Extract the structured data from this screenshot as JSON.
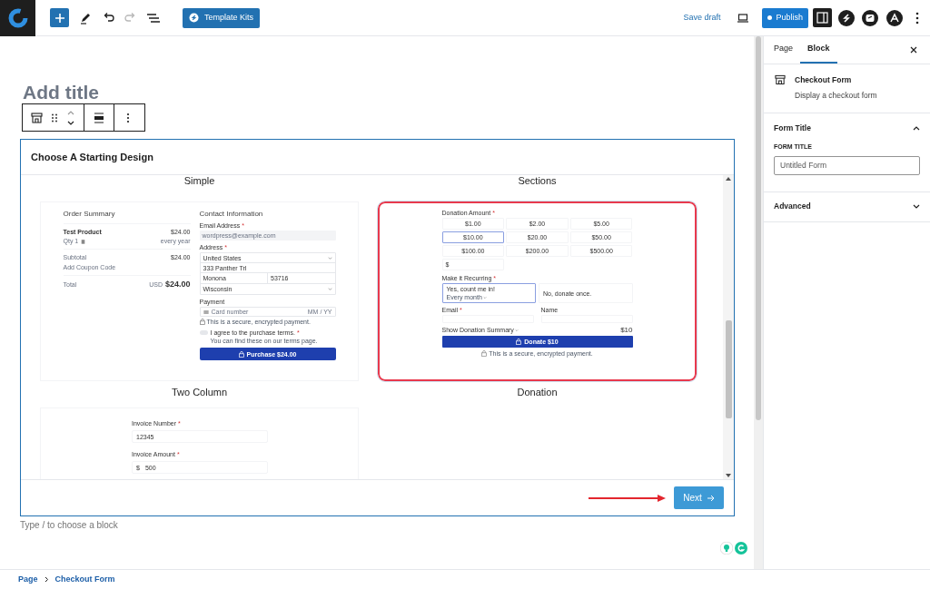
{
  "toolbar": {
    "template_kits": "Template Kits",
    "save_draft": "Save draft",
    "publish": "Publish",
    "redo_disabled": true,
    "settings_open": true
  },
  "editor": {
    "title_placeholder": "Add title",
    "appender_hint": "Type / to choose a block"
  },
  "design_picker": {
    "title": "Choose A Starting Design",
    "scrolled_labels": [
      "Simple",
      "Sections"
    ],
    "next": "Next",
    "designs": [
      {
        "kind": "two_column",
        "label": "Two Column",
        "selected": false,
        "order": {
          "title": "Order Summary",
          "product": "Test Product",
          "price": "$24.00",
          "qty": "Qty 1",
          "interval": "every year",
          "subtotal_label": "Subtotal",
          "subtotal": "$24.00",
          "coupon": "Add Coupon Code",
          "total_label": "Total",
          "currency": "USD",
          "total": "$24.00"
        },
        "contact": {
          "title": "Contact Information",
          "email_label": "Email Address",
          "email_mark": "*",
          "email_placeholder": "wordpress@example.com",
          "address_label": "Address",
          "address_mark": "*",
          "country": "United States",
          "street": "333 Panther Trl",
          "city": "Monona",
          "zip": "53716",
          "state": "Wisconsin",
          "payment_label": "Payment",
          "card_placeholder": "Card number",
          "expiry_placeholder": "MM / YY",
          "secure_note": "This is a secure, encrypted payment.",
          "terms": "I agree to the purchase terms.",
          "terms_mark": "*",
          "terms_note": "You can find these on our terms page.",
          "button": "Purchase $24.00"
        }
      },
      {
        "kind": "donation",
        "label": "Donation",
        "selected": true,
        "amount_label": "Donation Amount",
        "amount_mark": "*",
        "amounts": [
          {
            "text": "$1.00",
            "selected": false
          },
          {
            "text": "$2.00",
            "selected": false
          },
          {
            "text": "$5.00",
            "selected": false
          },
          {
            "text": "$10.00",
            "selected": true
          },
          {
            "text": "$20.00",
            "selected": false
          },
          {
            "text": "$50.00",
            "selected": false
          },
          {
            "text": "$100.00",
            "selected": false
          },
          {
            "text": "$200.00",
            "selected": false
          },
          {
            "text": "$500.00",
            "selected": false
          }
        ],
        "custom_amount": "$",
        "recurring_label": "Make it Recurring",
        "recurring_mark": "*",
        "recurring_options": [
          {
            "text": "Yes, count me in!",
            "detail": "Every month",
            "selected": true
          },
          {
            "text": "No, donate once.",
            "selected": false
          }
        ],
        "email_label": "Email",
        "email_mark": "*",
        "name_label": "Name",
        "summary_toggle": "Show Donation Summary",
        "summary_total": "$10",
        "button": "Donate $10",
        "secure_note": "This is a secure, encrypted payment."
      },
      {
        "kind": "invoice",
        "selected": false,
        "fields": [
          {
            "label": "Invoice Number",
            "mark": "*",
            "value": "12345"
          },
          {
            "label": "Invoice Amount",
            "mark": "*",
            "prefix": "$",
            "value": "500"
          }
        ]
      }
    ]
  },
  "sidebar": {
    "tabs": [
      {
        "label": "Page",
        "selected": false
      },
      {
        "label": "Block",
        "selected": true
      }
    ],
    "block": {
      "name": "Checkout Form",
      "description": "Display a checkout form"
    },
    "panels": [
      {
        "kind": "form_title",
        "title": "Form Title",
        "expanded": true,
        "field_label": "FORM TITLE",
        "value": "Untitled Form"
      },
      {
        "kind": "plain",
        "title": "Advanced",
        "expanded": false
      }
    ]
  },
  "breadcrumb": [
    "Page",
    "Checkout Form"
  ]
}
